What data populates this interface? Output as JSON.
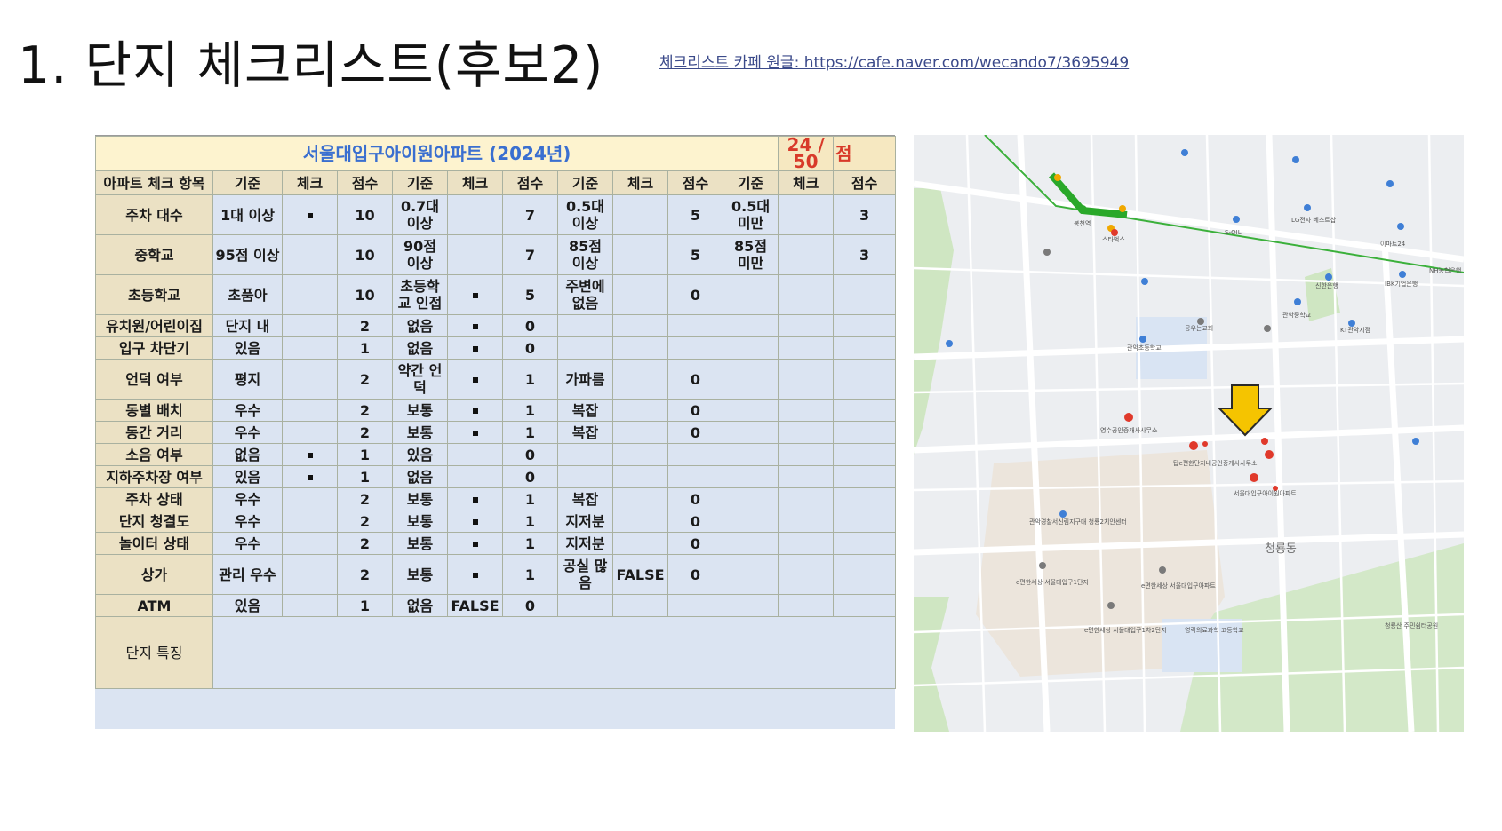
{
  "page": {
    "title": "1. 단지 체크리스트(후보2)",
    "source_link": "체크리스트 카페 원글: https://cafe.naver.com/wecando7/3695949"
  },
  "sheet": {
    "apartment_name": "서울대입구아이원아파트 (2024년)",
    "score_total": "24 / 50",
    "score_unit": "점",
    "columns": [
      "아파트 체크 항목",
      "기준",
      "체크",
      "점수",
      "기준",
      "체크",
      "점수",
      "기준",
      "체크",
      "점수",
      "기준",
      "체크",
      "점수"
    ],
    "rows": [
      {
        "item": "주차 대수",
        "c": [
          "1대 이상",
          "■",
          "10",
          "0.7대 이상",
          "",
          "7",
          "0.5대 이상",
          "",
          "5",
          "0.5대 미만",
          "",
          "3"
        ]
      },
      {
        "item": "중학교",
        "c": [
          "95점 이상",
          "",
          "10",
          "90점 이상",
          "",
          "7",
          "85점 이상",
          "",
          "5",
          "85점 미만",
          "",
          "3"
        ]
      },
      {
        "item": "초등학교",
        "c": [
          "초품아",
          "",
          "10",
          "초등학교 인접",
          "■",
          "5",
          "주변에 없음",
          "",
          "0",
          "",
          "",
          ""
        ]
      },
      {
        "item": "유치원/어린이집",
        "c": [
          "단지 내",
          "",
          "2",
          "없음",
          "■",
          "0",
          "",
          "",
          "",
          "",
          "",
          ""
        ]
      },
      {
        "item": "입구 차단기",
        "c": [
          "있음",
          "",
          "1",
          "없음",
          "■",
          "0",
          "",
          "",
          "",
          "",
          "",
          ""
        ]
      },
      {
        "item": "언덕 여부",
        "c": [
          "평지",
          "",
          "2",
          "약간 언덕",
          "■",
          "1",
          "가파름",
          "",
          "0",
          "",
          "",
          ""
        ]
      },
      {
        "item": "동별 배치",
        "c": [
          "우수",
          "",
          "2",
          "보통",
          "■",
          "1",
          "복잡",
          "",
          "0",
          "",
          "",
          ""
        ]
      },
      {
        "item": "동간 거리",
        "c": [
          "우수",
          "",
          "2",
          "보통",
          "■",
          "1",
          "복잡",
          "",
          "0",
          "",
          "",
          ""
        ]
      },
      {
        "item": "소음 여부",
        "c": [
          "없음",
          "■",
          "1",
          "있음",
          "",
          "0",
          "",
          "",
          "",
          "",
          "",
          ""
        ]
      },
      {
        "item": "지하주차장 여부",
        "c": [
          "있음",
          "■",
          "1",
          "없음",
          "",
          "0",
          "",
          "",
          "",
          "",
          "",
          ""
        ]
      },
      {
        "item": "주차 상태",
        "c": [
          "우수",
          "",
          "2",
          "보통",
          "■",
          "1",
          "복잡",
          "",
          "0",
          "",
          "",
          ""
        ]
      },
      {
        "item": "단지 청결도",
        "c": [
          "우수",
          "",
          "2",
          "보통",
          "■",
          "1",
          "지저분",
          "",
          "0",
          "",
          "",
          ""
        ]
      },
      {
        "item": "놀이터 상태",
        "c": [
          "우수",
          "",
          "2",
          "보통",
          "■",
          "1",
          "지저분",
          "",
          "0",
          "",
          "",
          ""
        ]
      },
      {
        "item": "상가",
        "c": [
          "관리 우수",
          "",
          "2",
          "보통",
          "■",
          "1",
          "공실 많음",
          "FALSE",
          "0",
          "",
          "",
          ""
        ]
      },
      {
        "item": "ATM",
        "c": [
          "있음",
          "",
          "1",
          "없음",
          "FALSE",
          "0",
          "",
          "",
          "",
          "",
          "",
          ""
        ]
      }
    ],
    "feature_label": "단지 특징"
  },
  "map": {
    "labels": {
      "station": "봉천역",
      "soil": "S-OIL",
      "starbucks": "스타벅스",
      "lg": "LG전자 베스트샵",
      "emart": "이마트24",
      "shinhan": "신한은행",
      "ibk": "IBK기업은행",
      "kt": "KT관악지점",
      "nh": "NH농협은행",
      "church": "공우는교회",
      "middle": "관악중학교",
      "elementary": "관악초등학교",
      "realtor1": "영수공인중개사사무소",
      "realtor2": "탑e편한단지내공인중개사사무소",
      "target": "서울대입구아이원아파트",
      "district": "청룡동",
      "e1": "e편한세상 서울대입구1단지",
      "e2": "e편한세상 서울대입구아파트",
      "e3": "e편한세상 서울대입구1차2단지",
      "highschool": "영락의료과학 고등학교",
      "park": "청룡산 주민쉼터공원",
      "center": "관악경찰서신림지구대 청룡2치안센터"
    },
    "arrow_color": "#f5c400",
    "marker_color": "#e0392b"
  }
}
